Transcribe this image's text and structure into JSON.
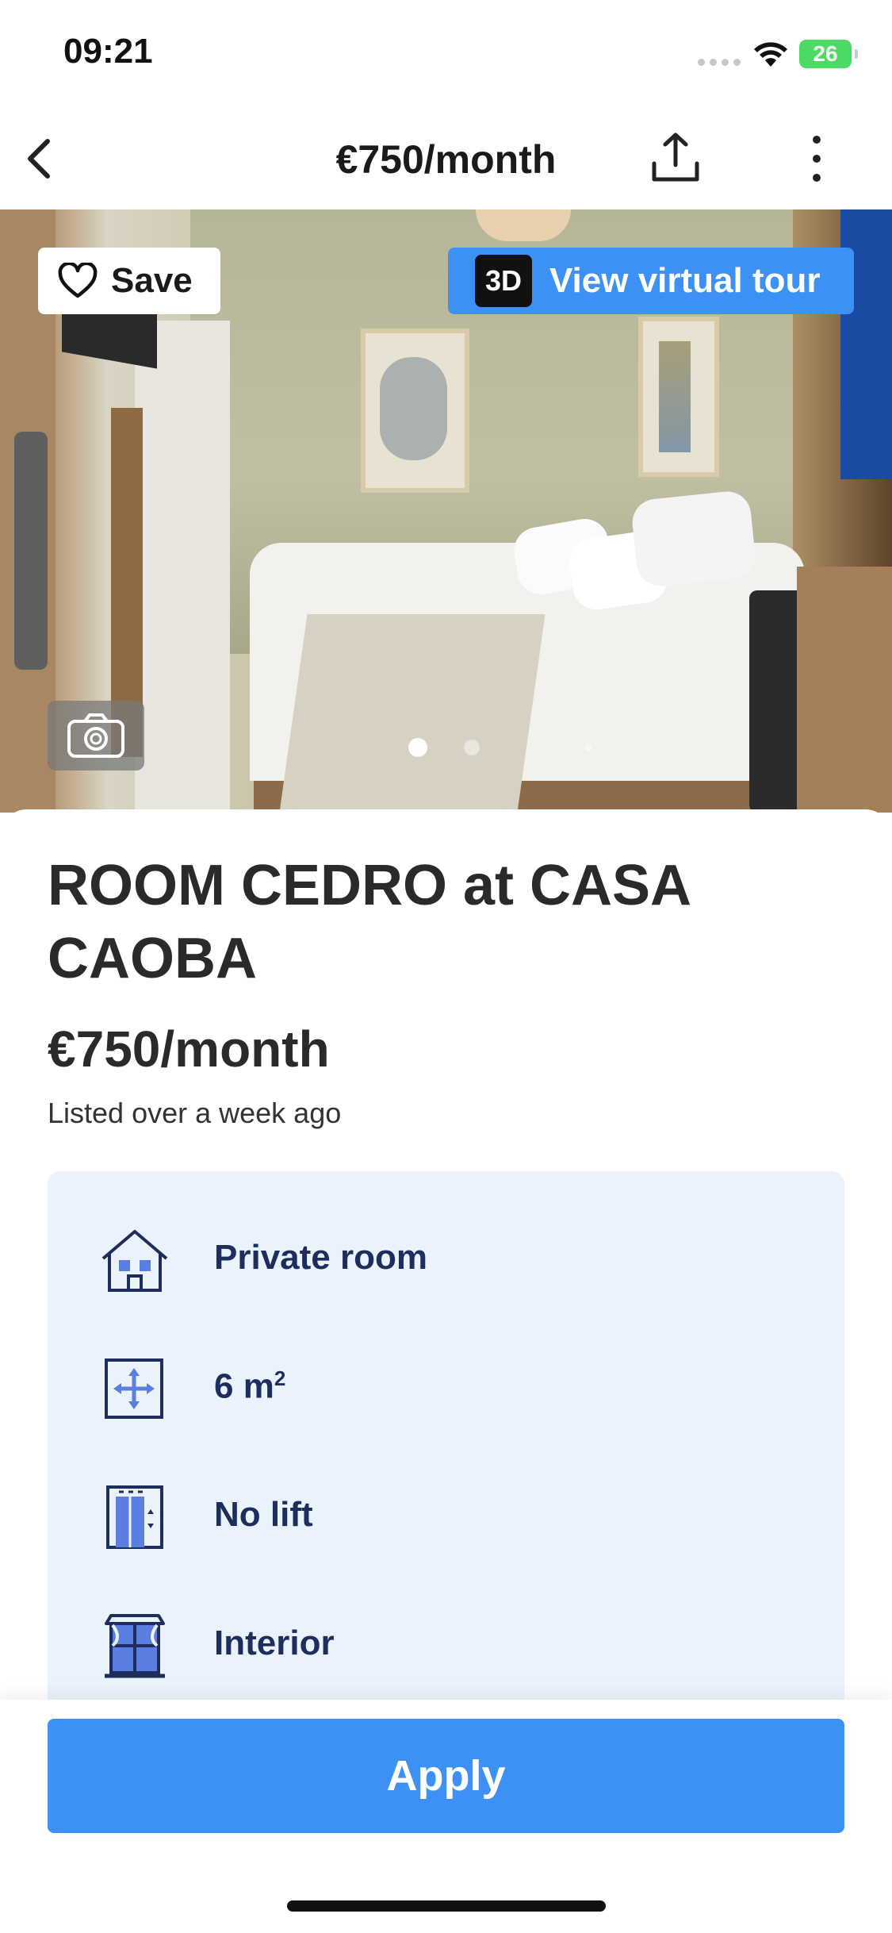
{
  "status_bar": {
    "time": "09:21",
    "battery": "26"
  },
  "nav": {
    "title": "€750/month",
    "back_icon": "chevron-left-icon",
    "share_icon": "share-icon",
    "more_icon": "more-vertical-icon"
  },
  "gallery": {
    "save_label": "Save",
    "tour_badge": "3D",
    "tour_label": "View virtual tour",
    "current_photo_index": 1,
    "photo_count": 3
  },
  "listing": {
    "title": "ROOM CEDRO at CASA CAOBA",
    "price": "€750/month",
    "listed": "Listed over a week ago"
  },
  "features": [
    {
      "label": "Private room",
      "icon": "house-icon"
    },
    {
      "label": "6 m",
      "sup": "2",
      "icon": "area-icon"
    },
    {
      "label": "No lift",
      "icon": "lift-icon"
    },
    {
      "label": "Interior",
      "icon": "window-icon"
    }
  ],
  "actions": {
    "apply_label": "Apply"
  },
  "colors": {
    "accent": "#3d91f5",
    "feature_bg": "#eaf3fc",
    "feature_text": "#1d2e5e"
  }
}
